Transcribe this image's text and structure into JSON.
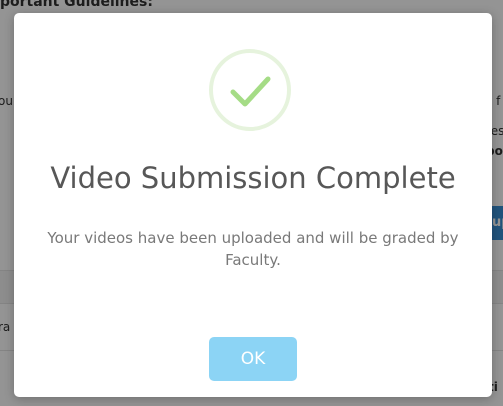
{
  "background": {
    "heading": "nportant Guidelines:",
    "left_fragment_1": "ou",
    "right_fragment_1": "s f",
    "right_fragment_2": "tes",
    "right_fragment_3": "bo",
    "button_fragment": "up",
    "band_fragment": "ra",
    "row_fragment": "ti"
  },
  "modal": {
    "icon": "checkmark-icon",
    "title": "Video Submission Complete",
    "message": "Your videos have been uploaded and will be graded by Faculty.",
    "ok_label": "OK"
  },
  "colors": {
    "check": "#a5dc86",
    "check_ring": "#e6f3dd",
    "ok_button": "#8cd4f5",
    "title": "#575757",
    "message": "#797979"
  }
}
